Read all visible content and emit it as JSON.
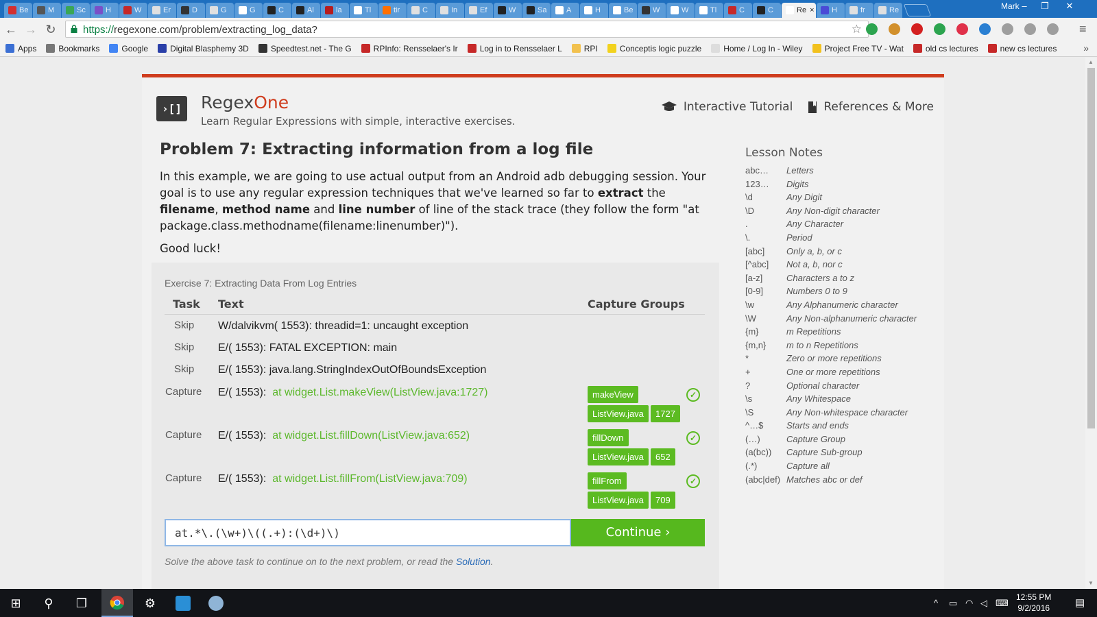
{
  "browser": {
    "tabs": [
      {
        "label": "Be",
        "color": "#d32f2f"
      },
      {
        "label": "M",
        "color": "#555555"
      },
      {
        "label": "Sc",
        "color": "#3aa655"
      },
      {
        "label": "H",
        "color": "#7a4fc7"
      },
      {
        "label": "W",
        "color": "#c62828"
      },
      {
        "label": "Er",
        "color": "#e0e0e0"
      },
      {
        "label": "D",
        "color": "#333333"
      },
      {
        "label": "G",
        "color": "#e0e0e0"
      },
      {
        "label": "G",
        "color": "#ffffff"
      },
      {
        "label": "C",
        "color": "#222222"
      },
      {
        "label": "Al",
        "color": "#222222"
      },
      {
        "label": "la",
        "color": "#b71c1c"
      },
      {
        "label": "Tl",
        "color": "#ffffff"
      },
      {
        "label": "tir",
        "color": "#ff6f00"
      },
      {
        "label": "C",
        "color": "#e0e0e0"
      },
      {
        "label": "In",
        "color": "#e0e0e0"
      },
      {
        "label": "Ef",
        "color": "#e0e0e0"
      },
      {
        "label": "W",
        "color": "#222222"
      },
      {
        "label": "Sa",
        "color": "#222222"
      },
      {
        "label": "A",
        "color": "#ffffff"
      },
      {
        "label": "H",
        "color": "#ffffff"
      },
      {
        "label": "Be",
        "color": "#ffffff"
      },
      {
        "label": "W",
        "color": "#333333"
      },
      {
        "label": "W",
        "color": "#ffffff"
      },
      {
        "label": "Tl",
        "color": "#ffffff"
      },
      {
        "label": "C",
        "color": "#c62828"
      },
      {
        "label": "C",
        "color": "#222222"
      },
      {
        "label": "Re",
        "color": "#ffffff",
        "active": true
      },
      {
        "label": "H",
        "color": "#4a4ad6"
      },
      {
        "label": "fr",
        "color": "#e0e0e0"
      },
      {
        "label": "Re",
        "color": "#e0e0e0"
      }
    ],
    "active_tab_close": "×",
    "profile_name": "Mark",
    "window_controls": {
      "minimize": "–",
      "restore": "❐",
      "close": "✕"
    },
    "toolbar": {
      "back_icon": "←",
      "forward_icon": "→",
      "reload_icon": "↻",
      "url_scheme": "https://",
      "url_rest": "regexone.com/problem/extracting_log_data?",
      "star_icon": "☆",
      "menu_icon": "≡",
      "extensions": [
        {
          "name": "grammarly-icon",
          "color": "#2ca44f"
        },
        {
          "name": "cookie-icon",
          "color": "#d2902c"
        },
        {
          "name": "adblock-plus-icon",
          "color": "#d42020"
        },
        {
          "name": "evernote-icon",
          "color": "#2ca44f"
        },
        {
          "name": "pocket-icon",
          "color": "#e0314a"
        },
        {
          "name": "sync-icon",
          "color": "#2a7fd2"
        },
        {
          "name": "keyboard-icon",
          "color": "#9e9e9e"
        },
        {
          "name": "lang-es-icon",
          "color": "#9e9e9e"
        },
        {
          "name": "cast-icon",
          "color": "#9e9e9e"
        }
      ]
    },
    "bookmarks": [
      {
        "label": "Apps",
        "color": "#3b6fd4"
      },
      {
        "label": "Bookmarks",
        "color": "#777777"
      },
      {
        "label": "Google",
        "color": "#4285f4"
      },
      {
        "label": "Digital Blasphemy 3D",
        "color": "#2a3fa8"
      },
      {
        "label": "Speedtest.net - The G",
        "color": "#333333"
      },
      {
        "label": "RPInfo: Rensselaer's Ir",
        "color": "#c62828"
      },
      {
        "label": "Log in to Rensselaer L",
        "color": "#c62828"
      },
      {
        "label": "RPI",
        "color": "#f2c14e"
      },
      {
        "label": "Conceptis logic puzzle",
        "color": "#f2d21e"
      },
      {
        "label": "Home / Log In - Wiley",
        "color": "#dddddd"
      },
      {
        "label": "Project Free TV - Wat",
        "color": "#f2c11e"
      },
      {
        "label": "old cs lectures",
        "color": "#c62828"
      },
      {
        "label": "new cs lectures",
        "color": "#c62828"
      }
    ],
    "bookmarks_more": "»"
  },
  "site": {
    "logo_text": "›[]",
    "brand_left": "Regex",
    "brand_right": "One",
    "tagline": "Learn Regular Expressions with simple, interactive exercises.",
    "nav": [
      {
        "label": "Interactive Tutorial",
        "icon": "graduation-cap-icon"
      },
      {
        "label": "References & More",
        "icon": "bookmark-icon"
      }
    ]
  },
  "problem": {
    "title": "Problem 7: Extracting information from a log file",
    "intro_1": "In this example, we are going to use actual output from an Android adb debugging session. Your goal is to use any regular expression techniques that we've learned so far to ",
    "intro_bold_1": "extract",
    "intro_2": " the ",
    "intro_bold_2": "filename",
    "intro_3": ", ",
    "intro_bold_3": "method name",
    "intro_4": " and ",
    "intro_bold_4": "line number",
    "intro_5": " of line of the stack trace (they follow the form \"at package.class.methodname(filename:linenumber)\").",
    "luck": "Good luck!"
  },
  "exercise": {
    "title": "Exercise 7: Extracting Data From Log Entries",
    "headers": {
      "task": "Task",
      "text": "Text",
      "groups": "Capture Groups"
    },
    "rows": [
      {
        "task": "Skip",
        "text": "W/dalvikvm( 1553): threadid=1: uncaught exception"
      },
      {
        "task": "Skip",
        "text": "E/( 1553): FATAL EXCEPTION: main"
      },
      {
        "task": "Skip",
        "text": "E/( 1553): java.lang.StringIndexOutOfBoundsException"
      },
      {
        "task": "Capture",
        "prefix": "E/( 1553):",
        "match": "at widget.List.makeView(ListView.java:1727)",
        "groups": [
          "makeView",
          "ListView.java",
          "1727"
        ]
      },
      {
        "task": "Capture",
        "prefix": "E/( 1553):",
        "match": "at widget.List.fillDown(ListView.java:652)",
        "groups": [
          "fillDown",
          "ListView.java",
          "652"
        ]
      },
      {
        "task": "Capture",
        "prefix": "E/( 1553):",
        "match": "at widget.List.fillFrom(ListView.java:709)",
        "groups": [
          "fillFrom",
          "ListView.java",
          "709"
        ]
      }
    ],
    "check_icon": "✓",
    "regex_value": "at.*\\.(\\w+)\\((.+):(\\d+)\\)",
    "continue_label": "Continue ›",
    "note_text": "Solve the above task to continue on to the next problem, or read the ",
    "note_link": "Solution",
    "note_end": "."
  },
  "lesson_notes": {
    "title": "Lesson Notes",
    "items": [
      {
        "sym": "abc…",
        "desc": "Letters"
      },
      {
        "sym": "123…",
        "desc": "Digits"
      },
      {
        "sym": "\\d",
        "desc": "Any Digit"
      },
      {
        "sym": "\\D",
        "desc": "Any Non-digit character"
      },
      {
        "sym": ".",
        "desc": "Any Character"
      },
      {
        "sym": "\\.",
        "desc": "Period"
      },
      {
        "sym": "[abc]",
        "desc": "Only a, b, or c"
      },
      {
        "sym": "[^abc]",
        "desc": "Not a, b, nor c"
      },
      {
        "sym": "[a-z]",
        "desc": "Characters a to z"
      },
      {
        "sym": "[0-9]",
        "desc": "Numbers 0 to 9"
      },
      {
        "sym": "\\w",
        "desc": "Any Alphanumeric character"
      },
      {
        "sym": "\\W",
        "desc": "Any Non-alphanumeric character"
      },
      {
        "sym": "{m}",
        "desc": "m Repetitions"
      },
      {
        "sym": "{m,n}",
        "desc": "m to n Repetitions"
      },
      {
        "sym": "*",
        "desc": "Zero or more repetitions"
      },
      {
        "sym": "+",
        "desc": "One or more repetitions"
      },
      {
        "sym": "?",
        "desc": "Optional character"
      },
      {
        "sym": "\\s",
        "desc": "Any Whitespace"
      },
      {
        "sym": "\\S",
        "desc": "Any Non-whitespace character"
      },
      {
        "sym": "^…$",
        "desc": "Starts and ends"
      },
      {
        "sym": "(…)",
        "desc": "Capture Group"
      },
      {
        "sym": "(a(bc))",
        "desc": "Capture Sub-group"
      },
      {
        "sym": "(.*)",
        "desc": "Capture all"
      },
      {
        "sym": "(abc|def)",
        "desc": "Matches abc or def"
      }
    ]
  },
  "taskbar": {
    "start_icon": "⊞",
    "search_icon": "⚲",
    "taskview_icon": "❐",
    "settings_icon": "⚙",
    "time": "12:55 PM",
    "date": "9/2/2016",
    "tray_up_icon": "^",
    "notification_icon": "▤"
  }
}
